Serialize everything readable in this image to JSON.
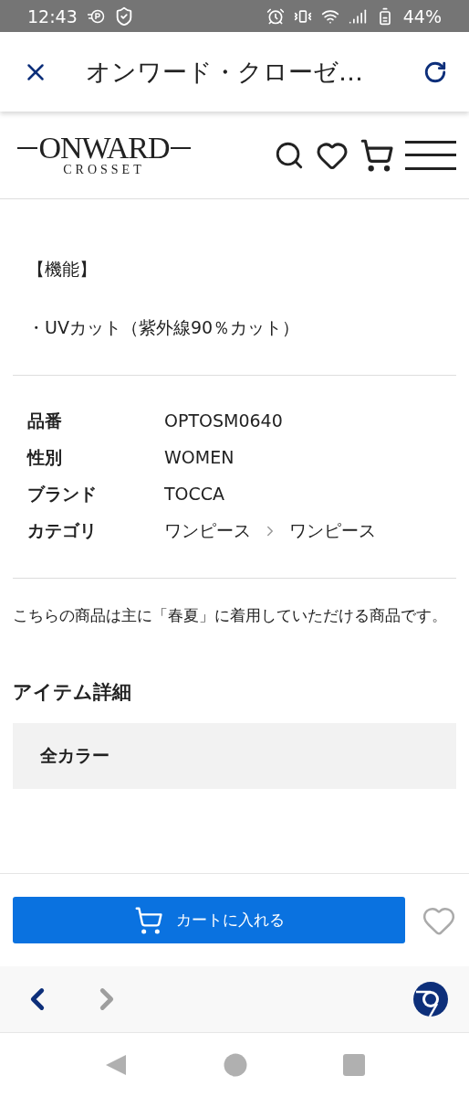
{
  "status_bar": {
    "time": "12:43",
    "battery": "44%"
  },
  "browser_bar": {
    "title": "オンワード・クローゼ…"
  },
  "site_header": {
    "logo_main": "ONWARD",
    "logo_sub": "CROSSET"
  },
  "features": {
    "heading": "【機能】",
    "bullets": [
      "・UVカット（紫外線90％カット）"
    ]
  },
  "specs": [
    {
      "label": "品番",
      "value": [
        "OPTOSM0640"
      ]
    },
    {
      "label": "性別",
      "value": [
        "WOMEN"
      ]
    },
    {
      "label": "ブランド",
      "value": [
        "TOCCA"
      ]
    },
    {
      "label": "カテゴリ",
      "value": [
        "ワンピース",
        "ワンピース"
      ]
    }
  ],
  "season_note": "こちらの商品は主に「春夏」に着用していただける商品です。",
  "item_details": {
    "heading": "アイテム詳細",
    "accordion": [
      {
        "label": "全カラー",
        "expanded": false
      }
    ]
  },
  "cart_button": {
    "label": "カートに入れる"
  },
  "browser_nav": [
    {
      "kind": "back",
      "disabled": false
    },
    {
      "kind": "forward",
      "disabled": true
    }
  ]
}
